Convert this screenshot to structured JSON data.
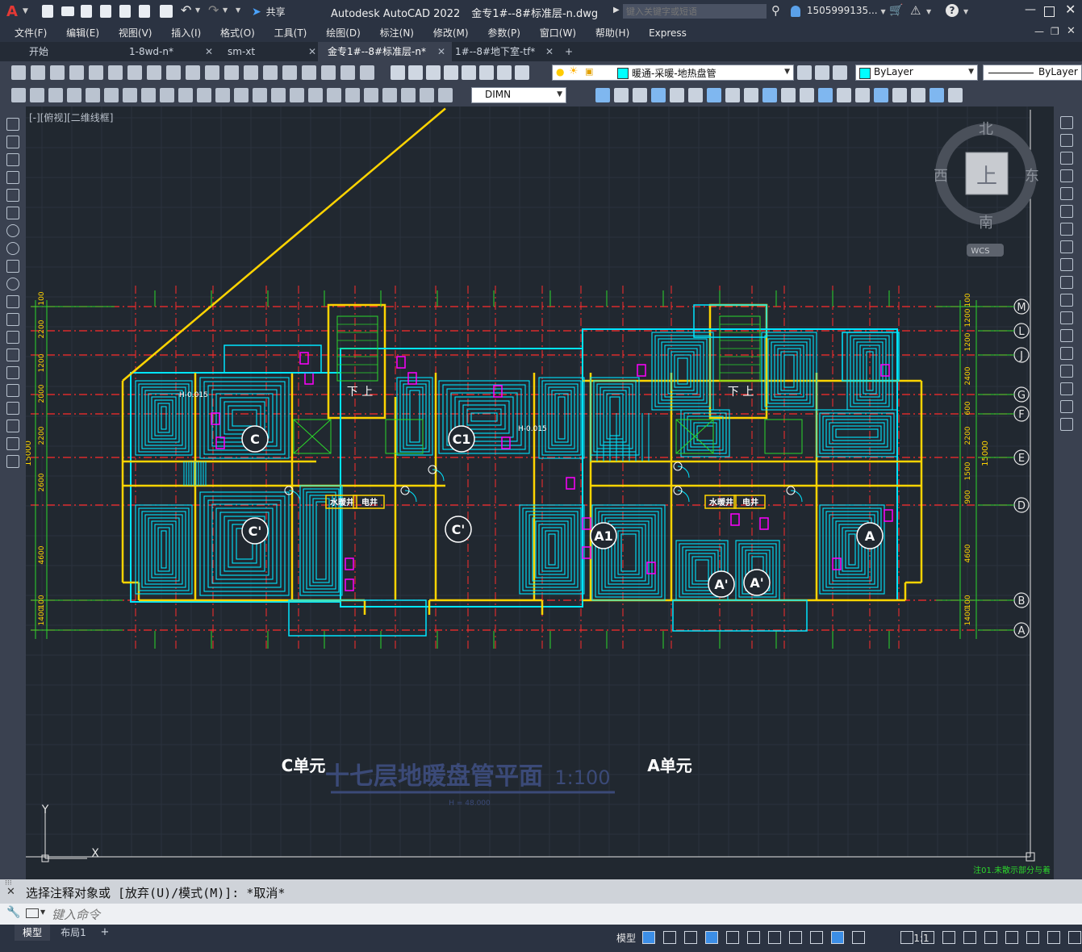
{
  "app_menu_letter": "A",
  "title": "Autodesk AutoCAD 2022",
  "filename": "金专1#--8#标准层-n.dwg",
  "quick_access_share": "共享",
  "search_placeholder": "键入关键字或短语",
  "user": "1505999135...",
  "menu": [
    "文件(F)",
    "编辑(E)",
    "视图(V)",
    "插入(I)",
    "格式(O)",
    "工具(T)",
    "绘图(D)",
    "标注(N)",
    "修改(M)",
    "参数(P)",
    "窗口(W)",
    "帮助(H)",
    "Express"
  ],
  "tabs": [
    {
      "label": "开始",
      "closable": false,
      "active": false
    },
    {
      "label": "1-8wd-n*",
      "closable": true,
      "active": false
    },
    {
      "label": "sm-xt",
      "closable": true,
      "active": false
    },
    {
      "label": "金专1#--8#标准层-n*",
      "closable": true,
      "active": true
    },
    {
      "label": "1#--8#地下室-tf*",
      "closable": true,
      "active": false
    }
  ],
  "tab_add": "+",
  "layer_name": "暖通-采暖-地热盘管",
  "color_value": "ByLayer",
  "linetype_value": "ByLayer",
  "dimstyle": "DIMN",
  "viewport_label": "[-][俯视][二维线框]",
  "viewcube": {
    "north": "北",
    "south": "南",
    "east": "东",
    "west": "西",
    "top": "上",
    "wcs": "WCS"
  },
  "drawing": {
    "title": "十七层地暖盘管平面",
    "scale": "1:100",
    "elevation": "H = 48.000",
    "unit_left": "C单元",
    "unit_right": "A单元",
    "stair_left": "下 上",
    "stair_right": "下 上",
    "rooms": [
      "C",
      "C1",
      "C'",
      "C'",
      "A1",
      "A",
      "A'",
      "A'"
    ],
    "shaft_labels": [
      "水暖井",
      "电井",
      "水暖井",
      "电井"
    ],
    "elev_marks": [
      "H-0.015",
      "H-0.015"
    ],
    "axis_right": [
      "M",
      "L",
      "J",
      "G",
      "F",
      "E",
      "D",
      "B",
      "A"
    ],
    "dims_left": [
      "100",
      "2200",
      "1200",
      "2000",
      "2200",
      "2600",
      "4600",
      "100",
      "1400"
    ],
    "dims_right": [
      "100",
      "1200",
      "1200",
      "2400",
      "600",
      "2200",
      "1500",
      "900",
      "4600",
      "100",
      "1400"
    ],
    "dim_total": "15000",
    "dim_left_total": "15000",
    "note": "注01.未散示部分与着"
  },
  "command_history": "选择注释对象或 [放弃(U)/模式(M)]: *取消*",
  "command_placeholder": "键入命令",
  "layout_tabs": [
    "模型",
    "布局1"
  ],
  "layout_add": "+",
  "status": {
    "model": "模型",
    "scale": "1:1"
  },
  "colors": {
    "titlebar": "#2b3342",
    "canvas": "#212830",
    "cyan": "#00e5ff",
    "yellow": "#ffd400",
    "red": "#ff2b2b",
    "green": "#2bd82b",
    "magenta": "#ff00ff",
    "accent_blue": "#3c8ee6"
  }
}
